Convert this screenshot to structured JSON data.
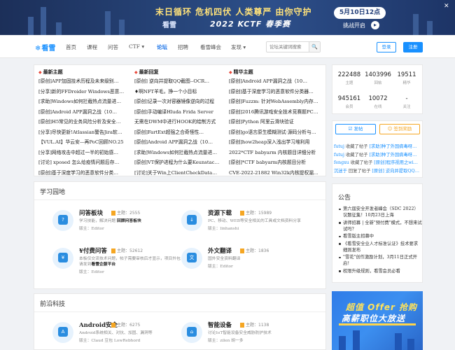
{
  "banner": {
    "title": "末日循环 危机四伏 人类尊严 由你守护",
    "brand": "看雪",
    "event": "2022 KCTF 春季赛",
    "date": "5月10日12点",
    "cta": "挑战开启",
    "cta_arrow": "▸",
    "close": "✕"
  },
  "nav": {
    "logo": "看雪",
    "logo_icon": "❄",
    "items": [
      "首页",
      "课程",
      "问答",
      "CTF ▾",
      "论坛",
      "招聘",
      "看雪峰会",
      "发现 ▾"
    ],
    "active_index": 4,
    "search_placeholder": "论坛关键词搜索",
    "search_icon": "🔍",
    "login": "登录",
    "register": "注册"
  },
  "topics": {
    "latest": {
      "head": "最新主题",
      "icon": "◆",
      "rows": [
        "[原创]APP加固技术历程及未来级别…",
        "[分享]新的FFDroider Windows恶意…",
        "[求助]Windows如何拦截热点流量进…",
        "[原创]Android APP漏洞之战（10…",
        "[原创]H5常见的业务风险分析及安全…",
        "[分享]尽快更新!Atlassian警告Jira软…",
        "【VUL.AI】华云安—再PoC回顾NO.25",
        "[分享]网络攻击中超过一半的初始感…",
        "[讨论] xposed 怎么给疫情问题后存…",
        "[原创]基于深度学习的恶意软件分类…"
      ]
    },
    "replies": {
      "head": "最新回复",
      "icon": "◆",
      "rows": [
        "[原创] 逆向并提取QQ截图--OCR…",
        "♦啊NFT羊毛，挣一个小目标",
        "[原创]记录一次对容器镜像逆向的过程",
        "[原创]手动编译Hluda Frida Server",
        "无需在DWM中进行HOOK的绘制方式",
        "[原创]FartExt超强之合奇怪性…",
        "[原创]Android APP漏洞之战（10…",
        "[求助]Windows如何拦截热点流量进…",
        "[原创]VT保护进程为什么要Keunstac…",
        "[讨论]关于Win上ClientCheckData…"
      ]
    },
    "featured": {
      "head": "精华主题",
      "icon": "◆",
      "rows": [
        "[原创]Android APP漏洞之战（10…",
        "[原创]基于深度学习的恶意软件分类器…",
        "[原创]Fuzzm: 针对WebAssembly内存…",
        "[原创]2016腾讯游戏安全技术竞赛题PC…",
        "[原创]Python 阿里云滑块验证",
        "[原创]go语言原生模糊测试·源码分析与…",
        "[原创]how2heap深入浅出学习堆利用",
        "2022*CTF babyarm 内核题目详细分析",
        "[原创]*CTF babyarm内核题目分析",
        "CVE-2022-21882 Win32k内核提权漏洞…"
      ]
    }
  },
  "stats": [
    {
      "num": "222488",
      "label": "主题"
    },
    {
      "num": "1403996",
      "label": "回帖"
    },
    {
      "num": "19511",
      "label": "精华"
    },
    {
      "num": "945161",
      "label": "会员"
    },
    {
      "num": "10072",
      "label": "在线"
    },
    {
      "num": "-",
      "label": "关注"
    }
  ],
  "actions": {
    "post": "☑ 发帖",
    "sign": "☺ 签到奖励"
  },
  "news": [
    {
      "user": "futuj",
      "verb": "收藏了帖子",
      "link": "[求助]种了外国病毒呀…"
    },
    {
      "user": "futuj",
      "verb": "收藏了帖子",
      "link": "[求助]种了外国病毒呀…"
    },
    {
      "user": "fengxu",
      "verb": "收藏了帖子",
      "link": "[原创]程序视用之wi…"
    },
    {
      "user": "沉迷于",
      "verb": "回复了帖子",
      "link": "[原创] 逆向并提取QQ…"
    }
  ],
  "garden": {
    "title": "学习园地",
    "cards": [
      {
        "name": "问答板块",
        "count_label": "主题：",
        "count": "2555",
        "desc": "学习技能，解决问题",
        "desc_bold": "回顾问答板块",
        "mod": "版主：Editor",
        "glyph": "?"
      },
      {
        "name": "资源下载",
        "count_label": "主题：",
        "count": "15989",
        "desc": "PC、移动、WEB等安全相关的工具或文档资料分享",
        "desc_bold": "",
        "mod": "版主：linhanshi",
        "glyph": "↓"
      },
      {
        "name": "¥付费问答",
        "count_label": "主题：",
        "count": "52612",
        "desc": "本板仅交流技术问题，帖子需要审核后才显示，项目外包请发到",
        "desc_bold": "看雪企服平台",
        "mod": "版主：Editor",
        "glyph": "¥"
      },
      {
        "name": "外文翻译",
        "count_label": "主题：",
        "count": "1836",
        "desc": "国外安全资料翻译",
        "desc_bold": "",
        "mod": "版主：Editor",
        "glyph": "文"
      }
    ]
  },
  "notice": {
    "title": "公告",
    "items": [
      "第六届安全开发者峰会（SDC 2022）议题征集！10月23日上海",
      "讲师招募 | 全新\"预付费\"模式，不想来试试吗？",
      "看雪版主招募中",
      "《看雪安全业人才标准认证》技术要求细则发布",
      "\"雪花\"创作激励计划，3月11日正式开启！",
      "权限升级规则，看雪会员必看"
    ]
  },
  "frontier": {
    "title": "前沿科技",
    "cards": [
      {
        "name": "Android安全",
        "count_label": "主题：",
        "count": "6275",
        "desc": "Android系统相关、对抗、加固、漏洞等",
        "mod": "版主：Claud 豆包 LowRebhord",
        "glyph": "A"
      },
      {
        "name": "智能设备",
        "count_label": "主题：",
        "count": "1138",
        "desc": "讨论IoT智能设备安全威胁防护技术",
        "mod": "版主：zilen 胡一多",
        "glyph": "⌂"
      }
    ]
  },
  "promo": {
    "line1": "超值 Offer 抢购",
    "line2": "高薪职位大放送"
  }
}
